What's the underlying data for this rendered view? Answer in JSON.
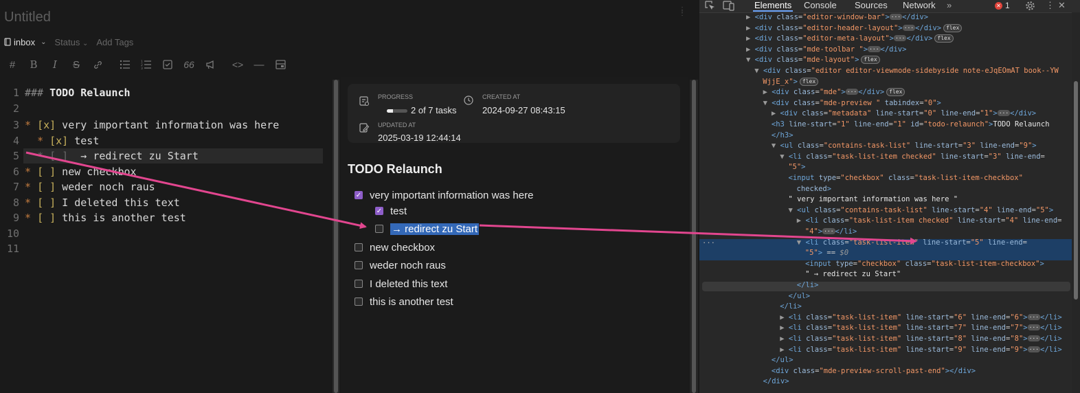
{
  "note": {
    "title": "Untitled",
    "notebook": "inbox",
    "status": "Status",
    "add_tags": "Add Tags"
  },
  "toolbar": [
    "heading-icon",
    "bold-icon",
    "italic-icon",
    "strikethrough-icon",
    "link-icon",
    "bullet-list-icon",
    "numbered-list-icon",
    "checkbox-icon",
    "quote-icon",
    "announce-icon",
    "code-icon",
    "horizontal-rule-icon",
    "preview-toggle-icon"
  ],
  "editor": {
    "lines": [
      {
        "n": "1",
        "text": "### TODO Relaunch"
      },
      {
        "n": "2",
        "text": ""
      },
      {
        "n": "3",
        "text": "* [x] very important information was here"
      },
      {
        "n": "4",
        "text": "  * [x] test"
      },
      {
        "n": "5",
        "text": "  * [ ]  → redirect zu Start"
      },
      {
        "n": "6",
        "text": "* [ ] new checkbox"
      },
      {
        "n": "7",
        "text": "* [ ] weder noch raus"
      },
      {
        "n": "8",
        "text": "* [ ] I deleted this text"
      },
      {
        "n": "9",
        "text": "* [ ] this is another test"
      },
      {
        "n": "10",
        "text": ""
      },
      {
        "n": "11",
        "text": ""
      }
    ]
  },
  "preview": {
    "progress_label": "PROGRESS",
    "progress_text": "2 of 7 tasks",
    "progress_done": 2,
    "progress_total": 7,
    "created_label": "CREATED AT",
    "created_value": "2024-09-27 08:43:15",
    "updated_label": "UPDATED AT",
    "updated_value": "2025-03-19 12:44:14",
    "heading": "TODO Relaunch",
    "tasks": [
      {
        "text": "very important information was here",
        "checked": true,
        "level": 0
      },
      {
        "text": "test",
        "checked": true,
        "level": 1
      },
      {
        "text": "→ redirect zu Start",
        "checked": false,
        "level": 1,
        "selected": true
      },
      {
        "text": "new checkbox",
        "checked": false,
        "level": 0
      },
      {
        "text": "weder noch raus",
        "checked": false,
        "level": 0
      },
      {
        "text": "I deleted this text",
        "checked": false,
        "level": 0
      },
      {
        "text": "this is another test",
        "checked": false,
        "level": 0
      }
    ]
  },
  "devtools": {
    "tabs": [
      "Elements",
      "Console",
      "Sources",
      "Network"
    ],
    "active_tab": "Elements",
    "more": "»",
    "error_count": "1",
    "tree": [
      {
        "i": 0,
        "tri": "▶",
        "html": "&lt;div <an>class</an>=<av>\"editor-window-bar\"</av>&gt;<e>…</e>&lt;/div&gt;"
      },
      {
        "i": 0,
        "tri": "▶",
        "html": "&lt;div <an>class</an>=<av>\"editor-header-layout\"</av>&gt;<e>…</e>&lt;/div&gt;<p>flex</p>"
      },
      {
        "i": 0,
        "tri": "▶",
        "html": "&lt;div <an>class</an>=<av>\"editor-meta-layout\"</av>&gt;<e>…</e>&lt;/div&gt;<p>flex</p>"
      },
      {
        "i": 0,
        "tri": "▶",
        "html": "&lt;div <an>class</an>=<av>\"mde-toolbar \"</av>&gt;<e>…</e>&lt;/div&gt;"
      },
      {
        "i": 0,
        "tri": "▼",
        "html": "&lt;div <an>class</an>=<av>\"mde-layout\"</av>&gt;<p>flex</p>"
      },
      {
        "i": 1,
        "tri": "▼",
        "html": "&lt;div <an>class</an>=<av>\"editor editor-viewmode-sidebyside note-eJqEOmAT book--YW</av>"
      },
      {
        "i": 1,
        "tri": "",
        "html": "<av>WjjE_x\"</av>&gt;<p>flex</p>"
      },
      {
        "i": 2,
        "tri": "▶",
        "html": "&lt;div <an>class</an>=<av>\"mde\"</av>&gt;<e>…</e>&lt;/div&gt;<p>flex</p>"
      },
      {
        "i": 2,
        "tri": "▼",
        "html": "&lt;div <an>class</an>=<av>\"mde-preview \"</av> <an>tabindex</an>=<av>\"0\"</av>&gt;"
      },
      {
        "i": 3,
        "tri": "▶",
        "html": "&lt;div <an>class</an>=<av>\"metadata\"</av> <an>line-start</an>=<av>\"0\"</av> <an>line-end</an>=<av>\"1\"</av>&gt;<e>…</e>&lt;/div&gt;"
      },
      {
        "i": 3,
        "tri": "",
        "html": "&lt;h3 <an>line-start</an>=<av>\"1\"</av> <an>line-end</an>=<av>\"1\"</av> <an>id</an>=<av>\"todo-relaunch\"</av>&gt;<t>TODO Relaunch</t>"
      },
      {
        "i": 3,
        "tri": "",
        "html": "&lt;/h3&gt;"
      },
      {
        "i": 3,
        "tri": "▼",
        "html": "&lt;ul <an>class</an>=<av>\"contains-task-list\"</av> <an>line-start</an>=<av>\"3\"</av> <an>line-end</an>=<av>\"9\"</av>&gt;"
      },
      {
        "i": 4,
        "tri": "▼",
        "html": "&lt;li <an>class</an>=<av>\"task-list-item checked\"</av> <an>line-start</an>=<av>\"3\"</av> <an>line-end</an>="
      },
      {
        "i": 4,
        "tri": "",
        "html": "<av>\"5\"</av>&gt;"
      },
      {
        "i": 5,
        "tri": "",
        "html": "&lt;input <an>type</an>=<av>\"checkbox\"</av> <an>class</an>=<av>\"task-list-item-checkbox\"</av>"
      },
      {
        "i": 5,
        "tri": "",
        "html": "<an>checked</an>&gt;"
      },
      {
        "i": 5,
        "tri": "",
        "html": "<t>\" very important information was here \"</t>"
      },
      {
        "i": 5,
        "tri": "▼",
        "html": "&lt;ul <an>class</an>=<av>\"contains-task-list\"</av> <an>line-start</an>=<av>\"4\"</av> <an>line-end</an>=<av>\"5\"</av>&gt;"
      },
      {
        "i": 6,
        "tri": "▶",
        "html": "&lt;li <an>class</an>=<av>\"task-list-item checked\"</av> <an>line-start</an>=<av>\"4\"</av> <an>line-end</an>="
      },
      {
        "i": 6,
        "tri": "",
        "html": "<av>\"4\"</av>&gt;<e>…</e>&lt;/li&gt;"
      },
      {
        "i": 6,
        "tri": "▼",
        "html": "&lt;li <an>class</an>=<av>\"task-list-item\"</av> <an>line-start</an>=<av>\"5\"</av> <an>line-end</an>="
      },
      {
        "i": 6,
        "tri": "",
        "html": "<av>\"5\"</av>&gt; == <i>$0</i>"
      },
      {
        "i": 7,
        "tri": "",
        "html": "&lt;input <an>type</an>=<av>\"checkbox\"</av> <an>class</an>=<av>\"task-list-item-checkbox\"</av>&gt;"
      },
      {
        "i": 7,
        "tri": "",
        "html": "<t>\" → redirect zu Start\"</t>"
      },
      {
        "i": 6,
        "tri": "",
        "html": "&lt;/li&gt;"
      },
      {
        "i": 5,
        "tri": "",
        "html": "&lt;/ul&gt;"
      },
      {
        "i": 4,
        "tri": "",
        "html": "&lt;/li&gt;"
      },
      {
        "i": 4,
        "tri": "▶",
        "html": "&lt;li <an>class</an>=<av>\"task-list-item\"</av> <an>line-start</an>=<av>\"6\"</av> <an>line-end</an>=<av>\"6\"</av>&gt;<e>…</e>&lt;/li&gt;"
      },
      {
        "i": 4,
        "tri": "▶",
        "html": "&lt;li <an>class</an>=<av>\"task-list-item\"</av> <an>line-start</an>=<av>\"7\"</av> <an>line-end</an>=<av>\"7\"</av>&gt;<e>…</e>&lt;/li&gt;"
      },
      {
        "i": 4,
        "tri": "▶",
        "html": "&lt;li <an>class</an>=<av>\"task-list-item\"</av> <an>line-start</an>=<av>\"8\"</av> <an>line-end</an>=<av>\"8\"</av>&gt;<e>…</e>&lt;/li&gt;"
      },
      {
        "i": 4,
        "tri": "▶",
        "html": "&lt;li <an>class</an>=<av>\"task-list-item\"</av> <an>line-start</an>=<av>\"9\"</av> <an>line-end</an>=<av>\"9\"</av>&gt;<e>…</e>&lt;/li&gt;"
      },
      {
        "i": 3,
        "tri": "",
        "html": "&lt;/ul&gt;"
      },
      {
        "i": 3,
        "tri": "",
        "html": "&lt;div <an>class</an>=<av>\"mde-preview-scroll-past-end\"</av>&gt;&lt;/div&gt;"
      },
      {
        "i": 2,
        "tri": "",
        "html": "&lt;/div&gt;"
      }
    ]
  },
  "colors": {
    "accent_checkbox": "#8e5ec9",
    "selection": "#3469b8",
    "annotation_arrow": "#e2468f",
    "devtools_selected_row": "#1d3f66"
  }
}
